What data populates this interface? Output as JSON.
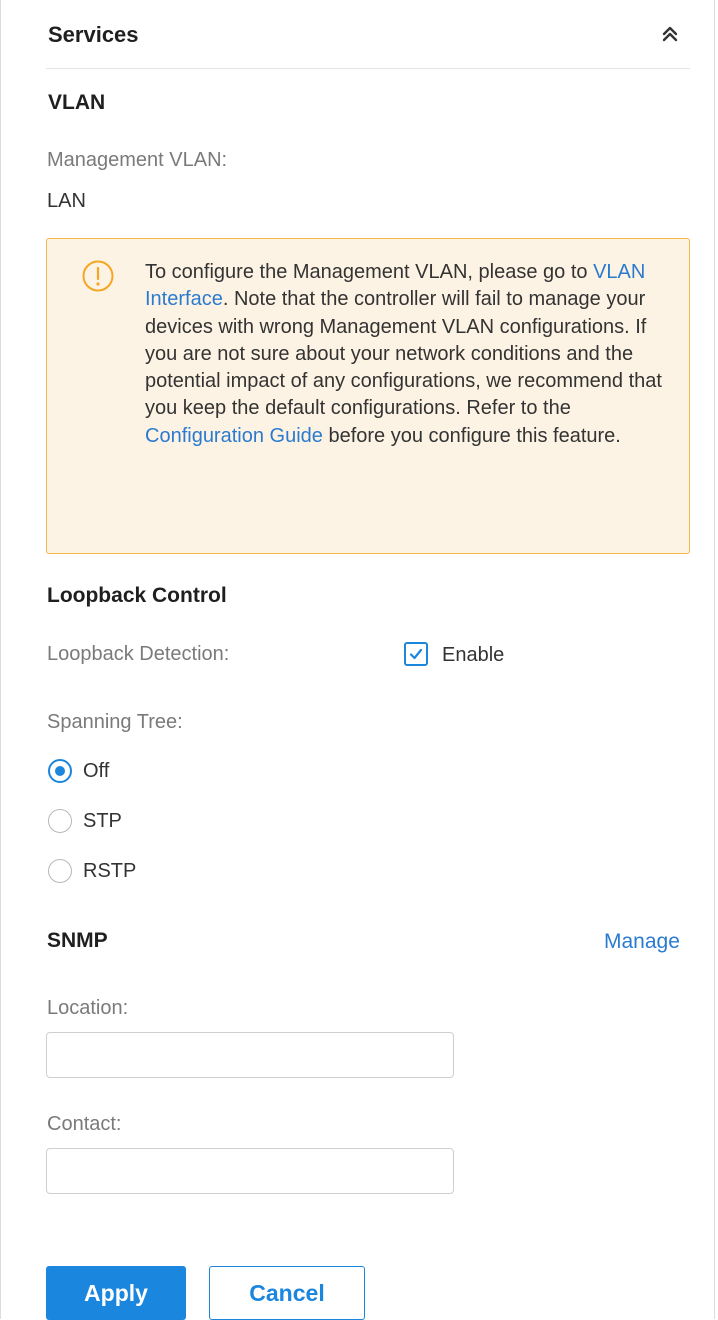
{
  "header": {
    "title": "Services",
    "collapse_icon": "double-chevron-up-icon"
  },
  "vlan": {
    "heading": "VLAN",
    "management_label": "Management VLAN:",
    "management_value": "LAN"
  },
  "notice": {
    "icon": "warning-circle-icon",
    "text_1": "To configure the Management VLAN, please go to ",
    "link_1": "VLAN Interface",
    "text_2": ". Note that the controller will fail to manage your devices with wrong Management VLAN configurations. If you are not sure about your network conditions and the potential impact of any configurations, we recommend that you keep the default configurations. Refer to the ",
    "link_2": "Configuration Guide",
    "text_3": " before you configure this feature."
  },
  "loopback": {
    "heading": "Loopback Control",
    "detection_label": "Loopback Detection:",
    "enable_label": "Enable",
    "enable_checked": true,
    "spanning_tree_label": "Spanning Tree:",
    "options": [
      {
        "label": "Off",
        "checked": true
      },
      {
        "label": "STP",
        "checked": false
      },
      {
        "label": "RSTP",
        "checked": false
      }
    ]
  },
  "snmp": {
    "heading": "SNMP",
    "manage_link": "Manage",
    "location_label": "Location:",
    "location_value": "",
    "contact_label": "Contact:",
    "contact_value": ""
  },
  "actions": {
    "apply_label": "Apply",
    "cancel_label": "Cancel"
  },
  "colors": {
    "accent": "#1b86dd",
    "warning_border": "#f5b94a",
    "warning_bg": "#fdf3e4",
    "link": "#2a7bd0"
  }
}
